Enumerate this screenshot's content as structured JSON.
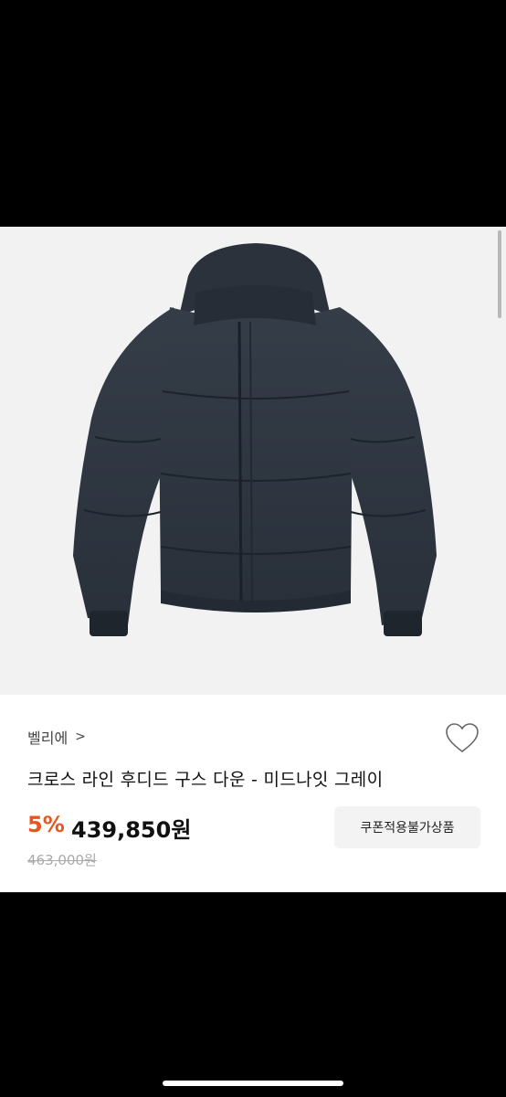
{
  "product": {
    "brand": "벨리에",
    "brand_chevron": ">",
    "title": "크로스 라인 후디드 구스 다운 - 미드나잇 그레이",
    "discount": "5%",
    "price": "439,850원",
    "original_price": "463,000원",
    "coupon_badge": "쿠폰적용불가상품",
    "favorite_icon": "heart-outline-icon"
  },
  "colors": {
    "accent_discount": "#e8561f",
    "jacket": "#2f3742"
  }
}
